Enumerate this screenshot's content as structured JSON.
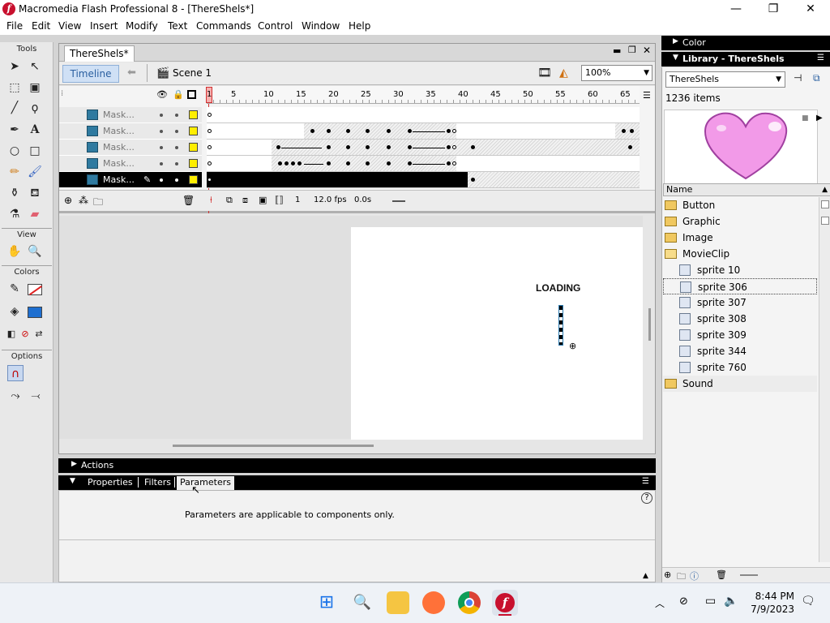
{
  "window": {
    "title": "Macromedia Flash Professional 8 - [ThereShels*]",
    "minimize": "—",
    "maximize": "❐",
    "close": "✕"
  },
  "menu": [
    "File",
    "Edit",
    "View",
    "Insert",
    "Modify",
    "Text",
    "Commands",
    "Control",
    "Window",
    "Help"
  ],
  "tools": {
    "title": "Tools",
    "view_label": "View",
    "colors_label": "Colors",
    "options_label": "Options"
  },
  "document": {
    "tab": "ThereShels*",
    "timeline_button": "Timeline",
    "scene": "Scene 1",
    "zoom": "100%",
    "ruler": [
      "1",
      "5",
      "10",
      "15",
      "20",
      "25",
      "30",
      "35",
      "40",
      "45",
      "50",
      "55",
      "60",
      "65"
    ],
    "layers": [
      "Mask...",
      "Mask...",
      "Mask...",
      "Mask...",
      "Mask..."
    ],
    "status": {
      "frame": "1",
      "fps": "12.0 fps",
      "time": "0.0s"
    },
    "stage_text": "LOADING"
  },
  "actions_panel": {
    "title": "Actions"
  },
  "properties_panel": {
    "tabs": [
      "Properties",
      "Filters",
      "Parameters"
    ],
    "message": "Parameters are applicable to components only."
  },
  "color_panel": {
    "title": "Color"
  },
  "library": {
    "title": "Library - ThereShels",
    "selected": "ThereShels",
    "count": "1236 items",
    "name_header": "Name",
    "items": [
      {
        "label": "Button",
        "type": "folder"
      },
      {
        "label": "Graphic",
        "type": "folder"
      },
      {
        "label": "Image",
        "type": "folder"
      },
      {
        "label": "MovieClip",
        "type": "folder-open"
      },
      {
        "label": "sprite 10",
        "type": "symbol"
      },
      {
        "label": "sprite 306",
        "type": "symbol",
        "selected": true
      },
      {
        "label": "sprite 307",
        "type": "symbol"
      },
      {
        "label": "sprite 308",
        "type": "symbol"
      },
      {
        "label": "sprite 309",
        "type": "symbol"
      },
      {
        "label": "sprite 344",
        "type": "symbol"
      },
      {
        "label": "sprite 760",
        "type": "symbol"
      },
      {
        "label": "Sound",
        "type": "folder"
      }
    ]
  },
  "taskbar": {
    "time": "8:44 PM",
    "date": "7/9/2023"
  },
  "colors": {
    "accent": "#c8102e",
    "keyframe_bg": "#000000",
    "layer_icon": "#2f7aa0",
    "heart": "#f29ae8"
  }
}
